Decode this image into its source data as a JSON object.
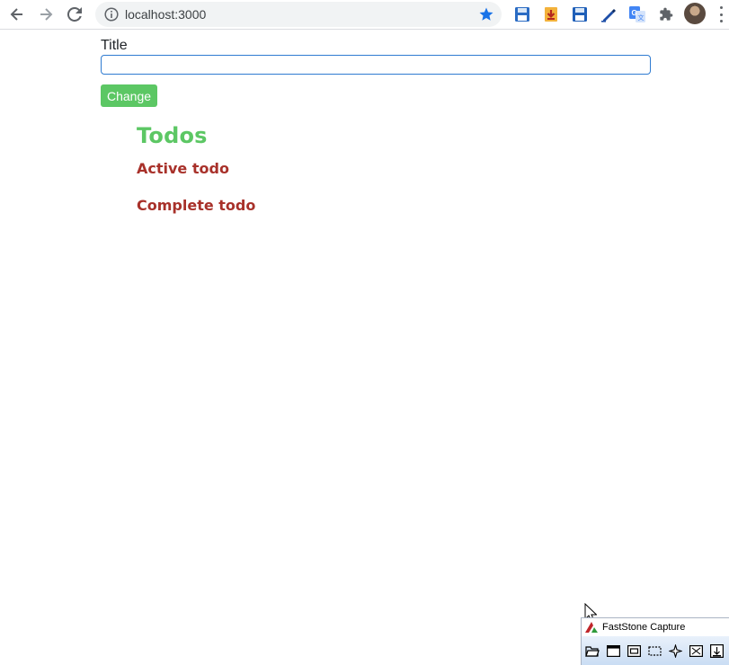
{
  "browser": {
    "url": "localhost:3000",
    "colors": {
      "star": "#1a73e8",
      "omnibox_bg": "#f1f3f4"
    },
    "nav": [
      "back-arrow-icon",
      "forward-arrow-icon",
      "reload-icon"
    ],
    "extensions": [
      "floppy-save-icon",
      "download-extension-icon",
      "floppy-save-icon",
      "highlighter-icon",
      "translate-icon",
      "puzzle-extensions-icon"
    ]
  },
  "form": {
    "title_label": "Title",
    "title_value": "",
    "change_label": "Change"
  },
  "todos": {
    "heading": "Todos",
    "active_heading": "Active todo",
    "complete_heading": "Complete todo"
  },
  "colors": {
    "accent_green": "#5cc764",
    "section_red": "#a8312a",
    "input_border": "#2f7bd1"
  },
  "faststone": {
    "title": "FastStone Capture",
    "tools": [
      "open-folder-icon",
      "capture-window-icon",
      "capture-object-icon",
      "capture-rectangle-icon",
      "capture-freehand-icon",
      "capture-fullscreen-icon",
      "capture-scrolling-icon"
    ]
  }
}
